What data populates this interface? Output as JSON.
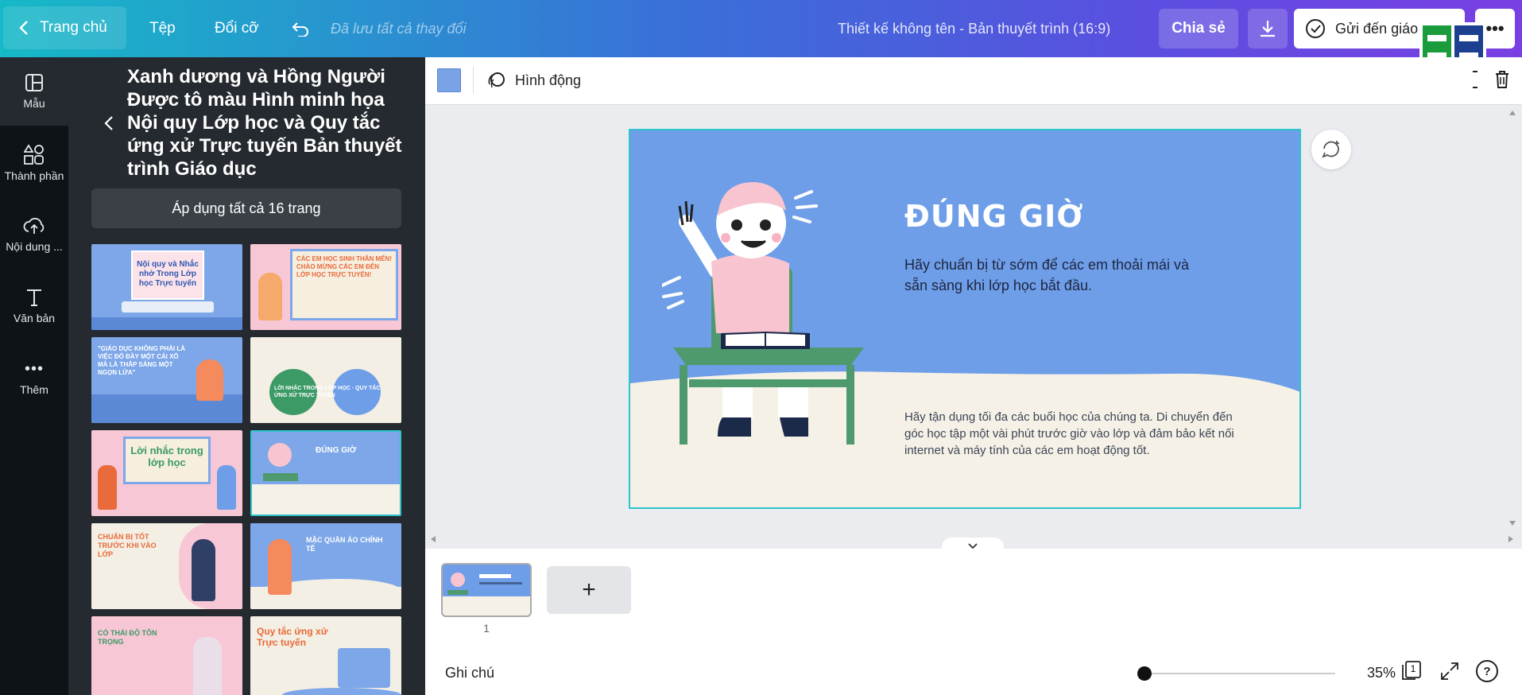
{
  "topbar": {
    "home_label": "Trang chủ",
    "file_label": "Tệp",
    "resize_label": "Đổi cỡ",
    "saved_status": "Đã lưu tất cả thay đổi",
    "design_title": "Thiết kế không tên - Bản thuyết trình (16:9)",
    "share_label": "Chia sẻ",
    "send_label": "Gửi đến giáo"
  },
  "rail": {
    "items": [
      {
        "label": "Mẫu",
        "icon": "layout-icon"
      },
      {
        "label": "Thành phần",
        "icon": "shapes-icon"
      },
      {
        "label": "Nội dung ...",
        "icon": "upload-cloud-icon"
      },
      {
        "label": "Văn bản",
        "icon": "text-icon"
      },
      {
        "label": "Thêm",
        "icon": "more-dots-icon"
      }
    ]
  },
  "panel": {
    "title": "Xanh dương và Hồng Người Được tô màu Hình minh họa Nội quy Lớp học và Quy tắc ứng xử Trực tuyến Bản thuyết trình Giáo dục",
    "apply_label": "Áp dụng tất cả 16 trang",
    "thumbs": [
      {
        "title": "Nội quy và Nhắc nhở Trong Lớp học Trực tuyến",
        "bg": "#7da7e8"
      },
      {
        "title": "CÁC EM HỌC SINH THÂN MẾN! CHÀO MỪNG CÁC EM ĐẾN LỚP HỌC TRỰC TUYẾN!",
        "bg": "#f7c7d6"
      },
      {
        "title": "\"GIÁO DỤC KHÔNG PHẢI LÀ VIỆC ĐỔ ĐẦY MỘT CÁI XÔ MÀ LÀ THẮP SÁNG MỘT NGỌN LỬA\"",
        "bg": "#7da7e8"
      },
      {
        "title": "LỜI NHẮC TRONG LỚP HỌC · QUY TẮC ỨNG XỬ TRỰC TUYẾN",
        "bg": "#f4efe4"
      },
      {
        "title": "Lời nhắc trong lớp học",
        "bg": "#f7c7d6"
      },
      {
        "title": "ĐÚNG GIỜ",
        "bg": "#7da7e8"
      },
      {
        "title": "CHUẨN BỊ TỐT TRƯỚC KHI VÀO LỚP",
        "bg": "#f4efe4"
      },
      {
        "title": "MẶC QUẦN ÁO CHỈNH TỀ",
        "bg": "#7da7e8"
      },
      {
        "title": "CÓ THÁI ĐỘ TÔN TRỌNG",
        "bg": "#f7c7d6"
      },
      {
        "title": "Quy tắc ứng xử Trực tuyến",
        "bg": "#f4efe4"
      }
    ]
  },
  "toolbar": {
    "color_swatch": "#7aa3e5",
    "animate_label": "Hình động"
  },
  "slide": {
    "heading": "ĐÚNG GIỜ",
    "subtitle": "Hãy chuẩn bị từ sớm để các em thoải mái và sẵn sàng khi lớp học bắt đầu.",
    "body": "Hãy tận dụng tối đa các buổi học của chúng ta. Di chuyển đến góc học tập một vài phút trước giờ vào lớp và đảm bảo kết nối internet và máy tính của các em hoạt động tốt.",
    "bg_color": "#6f9ee8",
    "ground_color": "#f5f1e6"
  },
  "pages": {
    "page_number": "1",
    "add_label": "+"
  },
  "footer": {
    "notes_label": "Ghi chú",
    "zoom_percent": "35%",
    "zoom_level": 0.0,
    "page_count": "1",
    "help_label": "?"
  }
}
